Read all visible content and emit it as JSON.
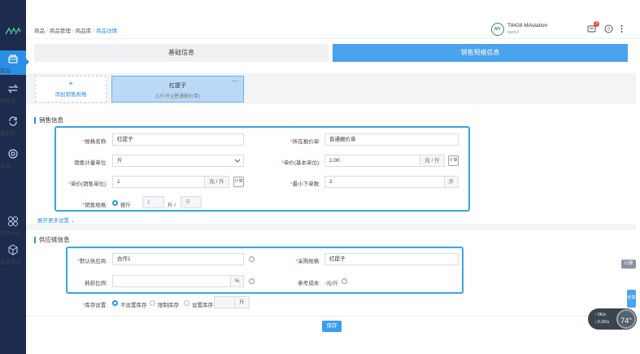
{
  "breadcrumb": [
    "商品",
    "商品管理",
    "商品库",
    "商品详情"
  ],
  "user": {
    "avatar": "MV",
    "name": "T8428 MAstation",
    "sub": "quick2"
  },
  "header_badge": "3",
  "sidebar": {
    "items": [
      {
        "label": "商品",
        "icon": "basket-icon"
      },
      {
        "label": "供应链",
        "icon": "swap-icon"
      },
      {
        "label": "进销存",
        "icon": "loop-icon"
      },
      {
        "label": "系统",
        "icon": "gear-icon"
      },
      {
        "label": "应用中心",
        "icon": "apps-icon"
      },
      {
        "label": "信息平台",
        "icon": "cube-icon"
      }
    ]
  },
  "tabs": {
    "base": "基础信息",
    "sales": "销售规格信息"
  },
  "spec": {
    "add_label": "添加销售规格",
    "card_title": "红提子",
    "card_sub": "(1斤/斤)(普通报价单)",
    "more": "···"
  },
  "sales_info": {
    "title": "销售信息",
    "fields": {
      "spec_name": {
        "label": "规格名称:",
        "value": "红提子"
      },
      "price_list": {
        "label": "所在报价单:",
        "value": "普通报价单"
      },
      "unit": {
        "label": "销售计量单位:",
        "value": "斤"
      },
      "unit_price": {
        "label": "单价(基本单位):",
        "value": "1.00",
        "suffix": "元 / 斤"
      },
      "sale_price": {
        "label": "单价(销售单位):",
        "value": "1",
        "suffix": "元 / 斤"
      },
      "min_order": {
        "label": "最小下单数:",
        "value": "2",
        "suffix": "斤"
      },
      "sales_spec": {
        "label": "销售规格:",
        "option": "按斤",
        "value": "1",
        "mid": "斤 /",
        "end": "斤"
      }
    },
    "calc_icon": "计算",
    "expand": "展开更多设置"
  },
  "supply_info": {
    "title": "供应链信息",
    "fields": {
      "default_supplier": {
        "label": "默认供应商:",
        "value": "合作1"
      },
      "purchase_spec": {
        "label": "采购规格:",
        "value": "红提子"
      },
      "loss_rate": {
        "label": "耗损比例:",
        "value": "",
        "suffix": "%"
      },
      "ref_cost": {
        "label": "参考成本:",
        "value": "-元/斤"
      },
      "stock": {
        "label": "库存设置:",
        "opt1": "不设置库存",
        "opt2": "限制库存",
        "opt3": "设置库存",
        "unit": "斤"
      }
    }
  },
  "save_label": "保存",
  "side_tag": "计算",
  "side_tag2": "反馈",
  "netmon": {
    "up": "0K/s",
    "down": "0.1K/s",
    "percent": "74",
    "unit": "%"
  }
}
